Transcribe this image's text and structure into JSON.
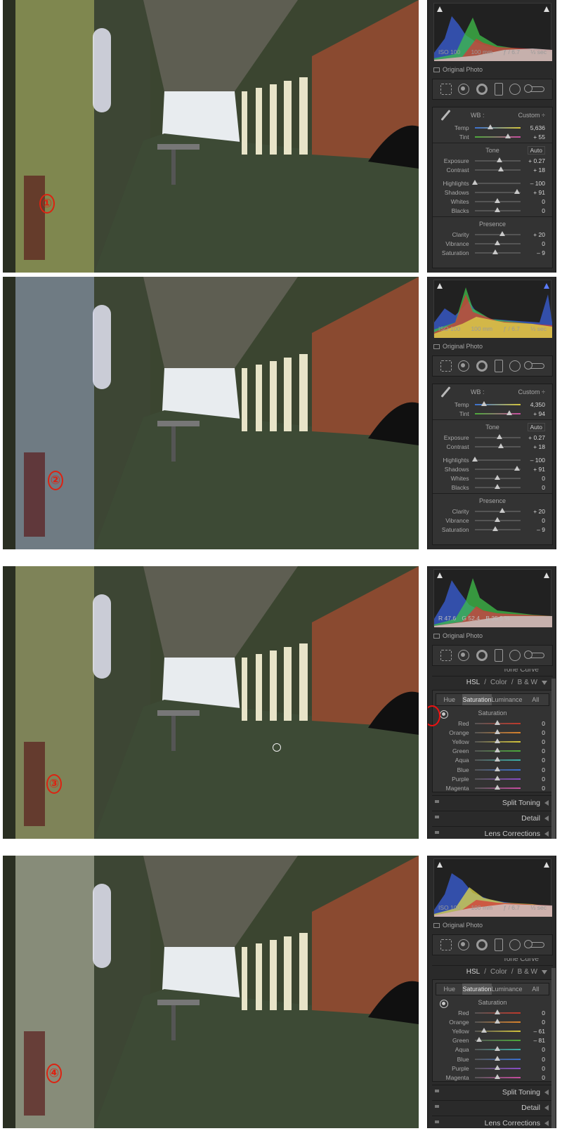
{
  "steps": [
    {
      "marker": "①",
      "histogram": {
        "iso": "ISO 100",
        "focal": "100 mm",
        "aperture": "ƒ / 6.7",
        "shutter": "⅓ sec"
      },
      "original_photo": "Original Photo",
      "wb": {
        "label": "WB :",
        "value": "Custom ÷"
      },
      "sliders_wb": [
        {
          "label": "Temp",
          "value": "5,636",
          "pos": 0.35
        },
        {
          "label": "Tint",
          "value": "+ 55",
          "pos": 0.72
        }
      ],
      "tone": {
        "title": "Tone",
        "auto": "Auto"
      },
      "sliders_tone": [
        {
          "label": "Exposure",
          "value": "+ 0.27",
          "pos": 0.54
        },
        {
          "label": "Contrast",
          "value": "+ 18",
          "pos": 0.58
        }
      ],
      "sliders_tone2": [
        {
          "label": "Highlights",
          "value": "– 100",
          "pos": 0.0
        },
        {
          "label": "Shadows",
          "value": "+ 91",
          "pos": 0.93
        },
        {
          "label": "Whites",
          "value": "0",
          "pos": 0.5
        },
        {
          "label": "Blacks",
          "value": "0",
          "pos": 0.5
        }
      ],
      "presence": {
        "title": "Presence"
      },
      "sliders_presence": [
        {
          "label": "Clarity",
          "value": "+ 20",
          "pos": 0.6
        },
        {
          "label": "Vibrance",
          "value": "0",
          "pos": 0.5
        },
        {
          "label": "Saturation",
          "value": "– 9",
          "pos": 0.45
        }
      ]
    },
    {
      "marker": "②",
      "histogram": {
        "iso": "ISO 100",
        "focal": "100 mm",
        "aperture": "ƒ / 6.7",
        "shutter": "⅓ sec"
      },
      "original_photo": "Original Photo",
      "wb": {
        "label": "WB :",
        "value": "Custom ÷"
      },
      "sliders_wb": [
        {
          "label": "Temp",
          "value": "4,350",
          "pos": 0.2
        },
        {
          "label": "Tint",
          "value": "+ 94",
          "pos": 0.76
        }
      ],
      "tone": {
        "title": "Tone",
        "auto": "Auto"
      },
      "sliders_tone": [
        {
          "label": "Exposure",
          "value": "+ 0.27",
          "pos": 0.54
        },
        {
          "label": "Contrast",
          "value": "+ 18",
          "pos": 0.58
        }
      ],
      "sliders_tone2": [
        {
          "label": "Highlights",
          "value": "– 100",
          "pos": 0.0
        },
        {
          "label": "Shadows",
          "value": "+ 91",
          "pos": 0.93
        },
        {
          "label": "Whites",
          "value": "0",
          "pos": 0.5
        },
        {
          "label": "Blacks",
          "value": "0",
          "pos": 0.5
        }
      ],
      "presence": {
        "title": "Presence"
      },
      "sliders_presence": [
        {
          "label": "Clarity",
          "value": "+ 20",
          "pos": 0.6
        },
        {
          "label": "Vibrance",
          "value": "0",
          "pos": 0.5
        },
        {
          "label": "Saturation",
          "value": "– 9",
          "pos": 0.45
        }
      ]
    },
    {
      "marker": "③",
      "readout": {
        "r": "R  47.6",
        "g": "G  52.4",
        "b": "B  35.5 %"
      },
      "original_photo": "Original Photo",
      "tone_curve_cut": "Tone Curve",
      "hsl_header": {
        "hsl": "HSL",
        "sep1": "/",
        "color": "Color",
        "sep2": "/",
        "bw": "B & W"
      },
      "tabs": [
        "Hue",
        "Saturation",
        "Luminance",
        "All"
      ],
      "tabs_selected": 1,
      "hsl_title": "Saturation",
      "hsl_rows": [
        {
          "label": "Red",
          "value": "0",
          "pos": 0.5,
          "color": "#c0392b"
        },
        {
          "label": "Orange",
          "value": "0",
          "pos": 0.5,
          "color": "#d9822b"
        },
        {
          "label": "Yellow",
          "value": "0",
          "pos": 0.5,
          "color": "#d4c43a"
        },
        {
          "label": "Green",
          "value": "0",
          "pos": 0.5,
          "color": "#4caa3a"
        },
        {
          "label": "Aqua",
          "value": "0",
          "pos": 0.5,
          "color": "#3ab0a8"
        },
        {
          "label": "Blue",
          "value": "0",
          "pos": 0.5,
          "color": "#3a6fd0"
        },
        {
          "label": "Purple",
          "value": "0",
          "pos": 0.5,
          "color": "#8a4cc8"
        },
        {
          "label": "Magenta",
          "value": "0",
          "pos": 0.5,
          "color": "#c84ca0"
        }
      ],
      "collapsed": [
        "Split Toning",
        "Detail",
        "Lens Corrections"
      ]
    },
    {
      "marker": "④",
      "histogram": {
        "iso": "ISO 100",
        "focal": "100 mm",
        "aperture": "ƒ / 6.7",
        "shutter": "⅓ sec"
      },
      "original_photo": "Original Photo",
      "tone_curve_cut": "Tone Curve",
      "hsl_header": {
        "hsl": "HSL",
        "sep1": "/",
        "color": "Color",
        "sep2": "/",
        "bw": "B & W"
      },
      "tabs": [
        "Hue",
        "Saturation",
        "Luminance",
        "All"
      ],
      "tabs_selected": 1,
      "hsl_title": "Saturation",
      "hsl_rows": [
        {
          "label": "Red",
          "value": "0",
          "pos": 0.5,
          "color": "#c0392b"
        },
        {
          "label": "Orange",
          "value": "0",
          "pos": 0.5,
          "color": "#d9822b"
        },
        {
          "label": "Yellow",
          "value": "– 61",
          "pos": 0.2,
          "color": "#d4c43a"
        },
        {
          "label": "Green",
          "value": "– 81",
          "pos": 0.1,
          "color": "#4caa3a"
        },
        {
          "label": "Aqua",
          "value": "0",
          "pos": 0.5,
          "color": "#3ab0a8"
        },
        {
          "label": "Blue",
          "value": "0",
          "pos": 0.5,
          "color": "#3a6fd0"
        },
        {
          "label": "Purple",
          "value": "0",
          "pos": 0.5,
          "color": "#8a4cc8"
        },
        {
          "label": "Magenta",
          "value": "0",
          "pos": 0.5,
          "color": "#c84ca0"
        }
      ],
      "collapsed": [
        "Split Toning",
        "Detail",
        "Lens Corrections"
      ]
    }
  ],
  "photo_tints": [
    "#b8bd6a",
    "#9aa7c8",
    "#b7b77a",
    "#c7c7b7"
  ]
}
